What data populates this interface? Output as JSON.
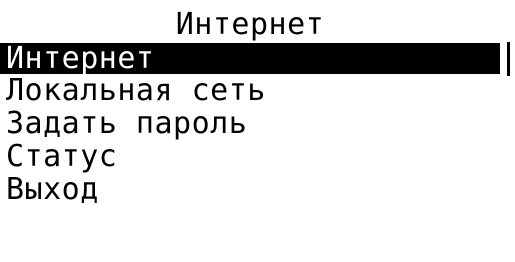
{
  "title": "Интернет",
  "menu": {
    "selected_index": 0,
    "items": [
      {
        "label": "Интернет"
      },
      {
        "label": "Локальная сеть"
      },
      {
        "label": "Задать пароль"
      },
      {
        "label": "Статус"
      },
      {
        "label": "Выход"
      }
    ]
  },
  "colors": {
    "background": "#ffffff",
    "foreground": "#000000",
    "highlight": "#000000",
    "highlight_text": "#ffffff"
  }
}
